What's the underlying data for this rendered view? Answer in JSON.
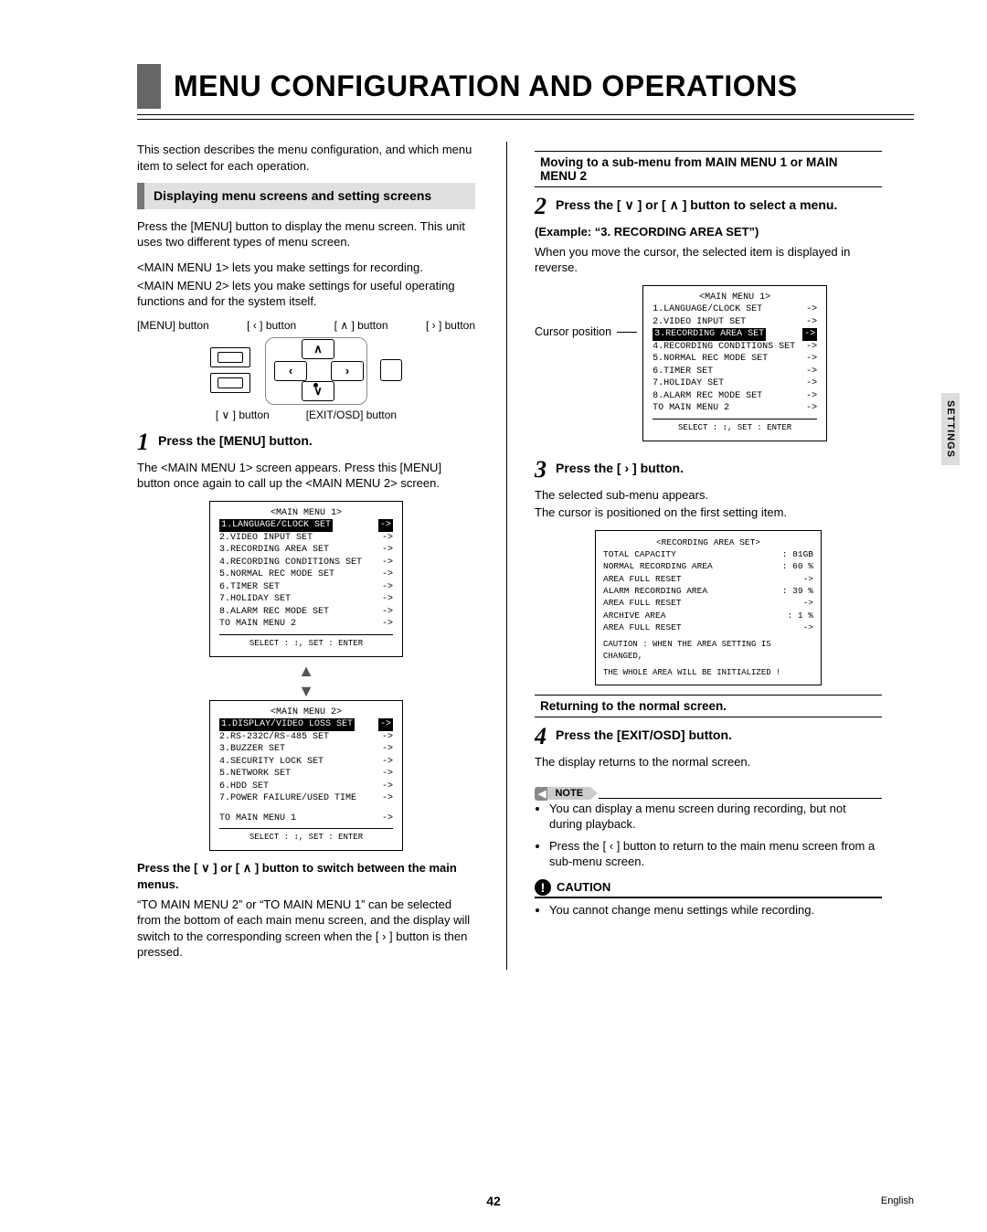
{
  "side_tab": "SETTINGS",
  "title": "MENU CONFIGURATION AND OPERATIONS",
  "intro": "This section describes the menu configuration, and which menu item to select for each operation.",
  "sub1": "Displaying menu screens and setting screens",
  "p1": "Press the [MENU] button to display the menu screen. This unit uses two different types of menu screen.",
  "p1b": "<MAIN MENU 1> lets you make settings for recording.",
  "p1c": "<MAIN MENU 2> lets you make settings for useful operating functions and for the system itself.",
  "hw": {
    "menu": "[MENU] button",
    "left": "[ ‹ ] button",
    "up": "[ ∧ ] button",
    "right": "[ › ] button",
    "down": "[ ∨ ] button",
    "exit": "[EXIT/OSD] button"
  },
  "step1": {
    "num": "1",
    "txt": "Press the [MENU] button."
  },
  "p2": "The <MAIN MENU 1> screen appears. Press this [MENU] button once again to call up the <MAIN MENU 2> screen.",
  "osd1": {
    "title": "<MAIN MENU 1>",
    "items": [
      "1.LANGUAGE/CLOCK SET",
      "2.VIDEO INPUT SET",
      "3.RECORDING AREA SET",
      "4.RECORDING CONDITIONS SET",
      "5.NORMAL REC MODE SET",
      "6.TIMER SET",
      "7.HOLIDAY SET",
      "8.ALARM REC MODE SET",
      "TO MAIN MENU 2"
    ],
    "footer": "SELECT : ↕,   SET : ENTER",
    "hl_index": 0
  },
  "osd2": {
    "title": "<MAIN MENU 2>",
    "items": [
      "1.DISPLAY/VIDEO LOSS SET",
      "2.RS-232C/RS-485 SET",
      "3.BUZZER SET",
      "4.SECURITY LOCK SET",
      "5.NETWORK SET",
      "6.HDD SET",
      "7.POWER FAILURE/USED TIME"
    ],
    "extra": "TO MAIN MENU 1",
    "footer": "SELECT : ↕,   SET : ENTER",
    "hl_index": 0
  },
  "p3_bold": "Press the [ ∨ ] or [ ∧ ] button to switch between the main menus.",
  "p3_body": "“TO MAIN MENU 2” or “TO MAIN MENU 1” can be selected from the bottom of each main menu screen, and the display will switch to the corresponding screen when the [ › ] button is then pressed.",
  "box2": "Moving to a sub-menu from MAIN MENU 1 or MAIN MENU 2",
  "step2": {
    "num": "2",
    "txt": "Press the [ ∨ ] or [ ∧ ] button to select a menu."
  },
  "example_label": "(Example: “3. RECORDING AREA SET”)",
  "example_body": "When you move the cursor, the selected item is displayed in reverse.",
  "cursor_label": "Cursor position",
  "osd3": {
    "title": "<MAIN MENU 1>",
    "items": [
      "1.LANGUAGE/CLOCK SET",
      "2.VIDEO INPUT SET",
      "3.RECORDING AREA SET",
      "4.RECORDING CONDITIONS SET",
      "5.NORMAL REC MODE SET",
      "6.TIMER SET",
      "7.HOLIDAY SET",
      "8.ALARM REC MODE SET",
      "TO MAIN MENU 2"
    ],
    "footer": "SELECT : ↕,   SET : ENTER",
    "hl_index": 2
  },
  "step3": {
    "num": "3",
    "txt": "Press the [ › ] button."
  },
  "p4a": "The selected sub-menu appears.",
  "p4b": "The cursor is positioned on the first setting item.",
  "osd4": {
    "title": "<RECORDING AREA SET>",
    "rows": [
      {
        "l": "TOTAL CAPACITY",
        "r": ":   81GB"
      },
      {
        "l": "NORMAL RECORDING AREA",
        "r": ":  60 %",
        "hl": true
      },
      {
        "l": "    AREA FULL RESET",
        "r": "->     "
      },
      {
        "l": "ALARM RECORDING AREA",
        "r": ":  39 %"
      },
      {
        "l": "    AREA FULL RESET",
        "r": "->     "
      },
      {
        "l": "ARCHIVE AREA",
        "r": ":   1 %"
      },
      {
        "l": "    AREA FULL RESET",
        "r": "->     "
      }
    ],
    "caution1": "CAUTION : WHEN THE AREA SETTING IS CHANGED,",
    "caution2": "          THE WHOLE AREA WILL BE INITIALIZED !"
  },
  "box3": "Returning to the normal screen.",
  "step4": {
    "num": "4",
    "txt": "Press the [EXIT/OSD] button."
  },
  "p5": "The display returns to the normal screen.",
  "note_label": "NOTE",
  "notes": [
    "You can display a menu screen during recording, but not during playback.",
    "Press the [ ‹ ] button to return to the main menu screen from a sub-menu screen."
  ],
  "caution_label": "CAUTION",
  "cautions": [
    "You cannot change menu settings while recording."
  ],
  "page_num": "42",
  "lang": "English"
}
